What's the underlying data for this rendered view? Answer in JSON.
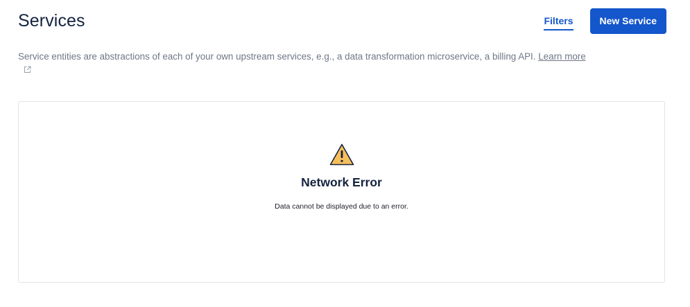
{
  "header": {
    "title": "Services",
    "filters_label": "Filters",
    "new_service_label": "New Service"
  },
  "description": {
    "text": "Service entities are abstractions of each of your own upstream services, e.g., a data transformation microservice, a billing API. ",
    "learn_more_label": "Learn more",
    "learn_more_icon": "external-link-icon"
  },
  "error": {
    "icon": "warning-icon",
    "title": "Network Error",
    "message": "Data cannot be displayed due to an error."
  },
  "colors": {
    "primary": "#1456cb",
    "warning_fill": "#f7bf5b",
    "title_text": "#14233f",
    "muted_text": "#6f7787",
    "card_border": "#e1e3e8"
  }
}
